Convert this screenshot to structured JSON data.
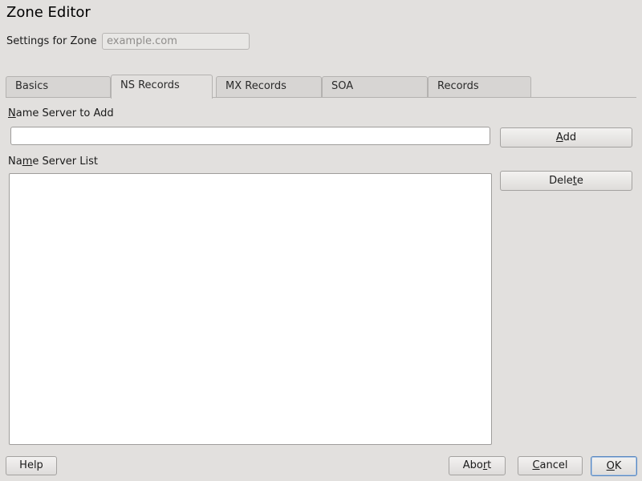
{
  "window": {
    "title": "Zone Editor"
  },
  "zone": {
    "label": "Settings for Zone",
    "value": "example.com"
  },
  "tabs": [
    {
      "label": "Basics",
      "active": false
    },
    {
      "label": "NS Records",
      "active": true
    },
    {
      "label": "MX Records",
      "active": false
    },
    {
      "label": "SOA",
      "active": false
    },
    {
      "label": "Records",
      "active": false
    }
  ],
  "ns": {
    "add_label_mnemonic": "N",
    "add_label_rest": "ame Server to Add",
    "add_input_value": "",
    "add_button_mnemonic": "A",
    "add_button_rest": "dd",
    "list_label_pre": "Na",
    "list_label_mnemonic": "m",
    "list_label_rest": "e Server List",
    "list_items": [],
    "delete_button_pre": "Dele",
    "delete_button_mnemonic": "t",
    "delete_button_rest": "e"
  },
  "footer": {
    "help_label": "Help",
    "abort_pre": "Abo",
    "abort_mnemonic": "r",
    "abort_rest": "t",
    "cancel_mnemonic": "C",
    "cancel_rest": "ancel",
    "ok_mnemonic": "O",
    "ok_rest": "K"
  }
}
